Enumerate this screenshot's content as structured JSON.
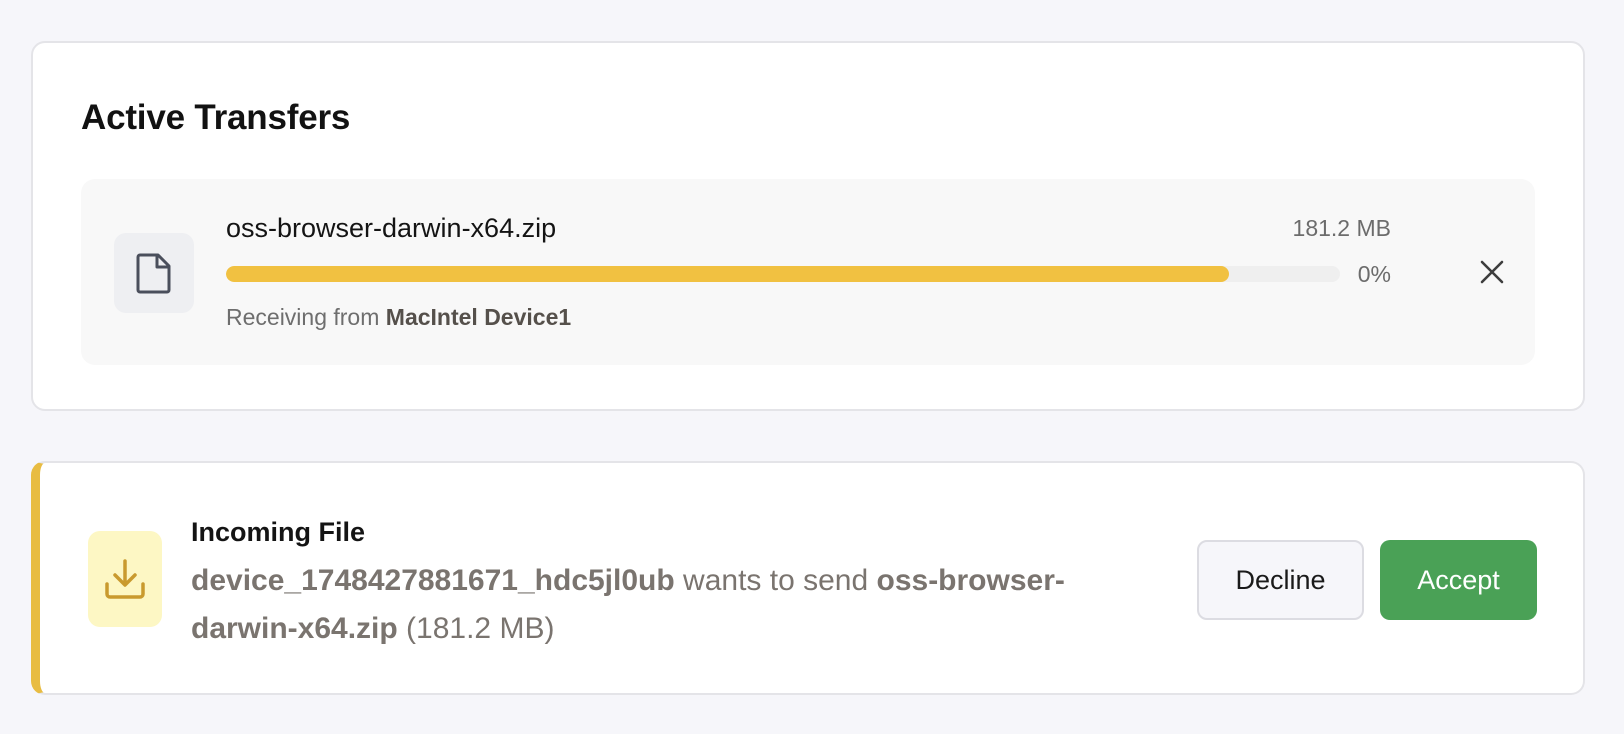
{
  "active_transfers": {
    "title": "Active Transfers",
    "items": [
      {
        "file_name": "oss-browser-darwin-x64.zip",
        "file_size": "181.2 MB",
        "progress_label": "0%",
        "progress_fraction": 0.9,
        "receiving_prefix": "Receiving from ",
        "device_name": "MacIntel Device1",
        "icon": "file-icon",
        "cancel_icon": "close-icon"
      }
    ]
  },
  "incoming": {
    "title": "Incoming File",
    "sender": "device_1748427881671_hdc5jl0ub",
    "middle_text": " wants to send ",
    "file_name": "oss-browser-darwin-x64.zip",
    "size_text": " (181.2 MB)",
    "icon": "download-icon",
    "decline_label": "Decline",
    "accept_label": "Accept"
  },
  "colors": {
    "accent_yellow": "#f1c141",
    "accept_green": "#4aa156",
    "incoming_border": "#e8bc42",
    "download_icon": "#c99a2e"
  }
}
